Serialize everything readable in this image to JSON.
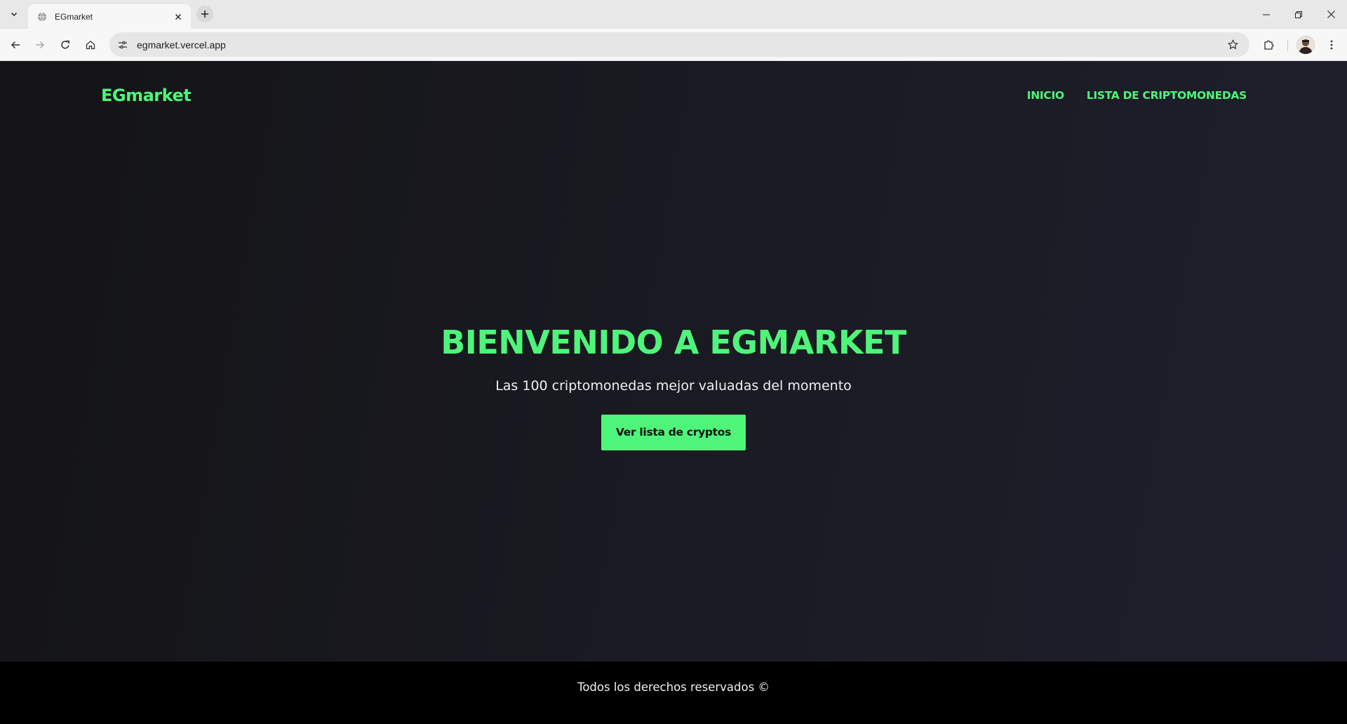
{
  "browser": {
    "tab": {
      "title": "EGmarket"
    },
    "url": "egmarket.vercel.app",
    "icons": {
      "tab_list": "chevron-down-icon",
      "tab_favicon": "globe-icon",
      "tab_close": "close-icon",
      "new_tab": "plus-icon",
      "back": "arrow-left-icon",
      "forward": "arrow-right-icon",
      "reload": "reload-icon",
      "home": "home-icon",
      "site_info": "tune-icon",
      "bookmark": "star-icon",
      "extensions": "puzzle-icon",
      "menu": "kebab-menu-icon",
      "minimize": "minimize-icon",
      "restore": "restore-icon",
      "close_window": "close-icon"
    }
  },
  "site": {
    "brand": "EGmarket",
    "nav": [
      {
        "label": "INICIO"
      },
      {
        "label": "LISTA DE CRIPTOMONEDAS"
      }
    ],
    "hero": {
      "title": "BIENVENIDO A EGMARKET",
      "subtitle": "Las 100 criptomonedas mejor valuadas del momento",
      "cta": "Ver lista de cryptos"
    },
    "footer": "Todos los derechos reservados ©"
  },
  "colors": {
    "accent": "#4ef57a",
    "background": "#1a1b22",
    "footer_bg": "#000000",
    "text": "#f1f1f1"
  }
}
